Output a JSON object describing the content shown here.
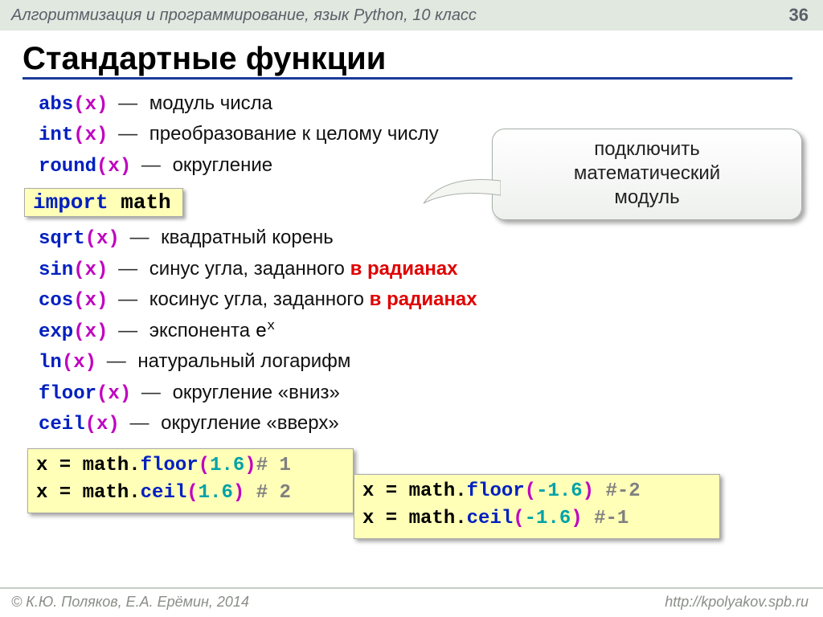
{
  "header": {
    "course": "Алгоритмизация и программирование, язык Python, 10 класс",
    "page": "36"
  },
  "title": "Стандартные функции",
  "callout": {
    "line1": "подключить",
    "line2": "математический",
    "line3": "модуль"
  },
  "import": {
    "kw": "import",
    "mod": "math"
  },
  "fns": [
    {
      "name": "abs",
      "arg": "(x)",
      "desc": "модуль числа"
    },
    {
      "name": "int",
      "arg": "(x)",
      "desc": "преобразование к целому числу"
    },
    {
      "name": "round",
      "arg": "(x)",
      "desc": "округление"
    }
  ],
  "mathfns": [
    {
      "name": "sqrt",
      "arg": "(x)",
      "desc": "квадратный корень"
    },
    {
      "name": "sin",
      "arg": "(x)",
      "desc_pre": "синус угла, заданного ",
      "desc_em": "в радианах"
    },
    {
      "name": "cos",
      "arg": "(x)",
      "desc_pre": "косинус угла, заданного ",
      "desc_em": "в радианах"
    },
    {
      "name": "exp",
      "arg": "(x)",
      "desc": "экспонента ",
      "sup": "e",
      "supx": "x"
    },
    {
      "name": "ln",
      "arg": "(x)",
      "desc": "натуральный логарифм"
    },
    {
      "name": "floor",
      "arg": "(x)",
      "desc": "округление «вниз»"
    },
    {
      "name": "ceil",
      "arg": "(x)",
      "desc": "округление «вверх»"
    }
  ],
  "ex1": {
    "l1": {
      "var": "x",
      "eq": " = ",
      "mod": "math",
      "dot": ".",
      "fn": "floor",
      "open": "(",
      "num": "1.6",
      "close": ")",
      "cmt": "# 1"
    },
    "l2": {
      "var": "x",
      "eq": " = ",
      "mod": "math",
      "dot": ".",
      "fn": "ceil",
      "open": "(",
      "num": "1.6",
      "close": ") ",
      "cmt": "# 2"
    }
  },
  "ex2": {
    "l1": {
      "var": "x",
      "eq": " = ",
      "mod": "math",
      "dot": ".",
      "fn": "floor",
      "open": "(",
      "num": "-1.6",
      "close": ") ",
      "cmt": "#-2"
    },
    "l2": {
      "var": "x",
      "eq": " = ",
      "mod": "math",
      "dot": ".",
      "fn": "ceil",
      "open": "(",
      "num": "-1.6",
      "close": ")  ",
      "cmt": "#-1"
    }
  },
  "footer": {
    "left": "© К.Ю. Поляков, Е.А. Ерёмин, 2014",
    "right": "http://kpolyakov.spb.ru"
  }
}
